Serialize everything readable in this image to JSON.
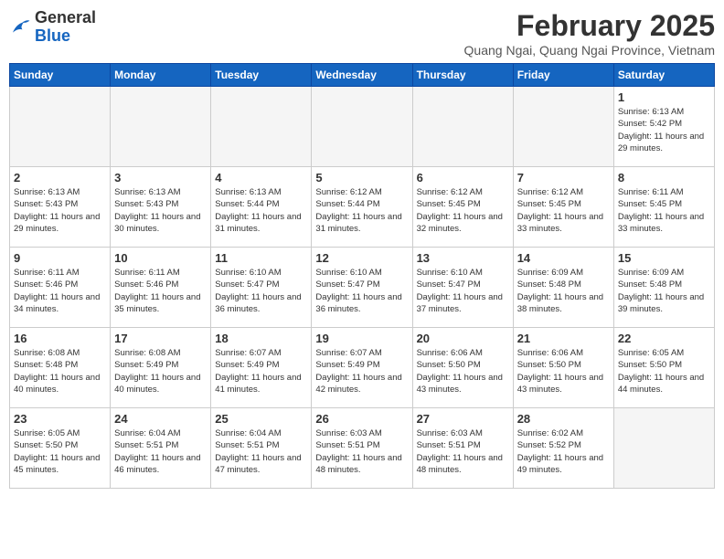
{
  "header": {
    "logo_general": "General",
    "logo_blue": "Blue",
    "title": "February 2025",
    "subtitle": "Quang Ngai, Quang Ngai Province, Vietnam"
  },
  "days_of_week": [
    "Sunday",
    "Monday",
    "Tuesday",
    "Wednesday",
    "Thursday",
    "Friday",
    "Saturday"
  ],
  "weeks": [
    [
      {
        "day": null
      },
      {
        "day": null
      },
      {
        "day": null
      },
      {
        "day": null
      },
      {
        "day": null
      },
      {
        "day": null
      },
      {
        "day": 1,
        "sunrise": "6:13 AM",
        "sunset": "5:42 PM",
        "daylight": "11 hours and 29 minutes."
      }
    ],
    [
      {
        "day": 2,
        "sunrise": "6:13 AM",
        "sunset": "5:43 PM",
        "daylight": "11 hours and 29 minutes."
      },
      {
        "day": 3,
        "sunrise": "6:13 AM",
        "sunset": "5:43 PM",
        "daylight": "11 hours and 30 minutes."
      },
      {
        "day": 4,
        "sunrise": "6:13 AM",
        "sunset": "5:44 PM",
        "daylight": "11 hours and 31 minutes."
      },
      {
        "day": 5,
        "sunrise": "6:12 AM",
        "sunset": "5:44 PM",
        "daylight": "11 hours and 31 minutes."
      },
      {
        "day": 6,
        "sunrise": "6:12 AM",
        "sunset": "5:45 PM",
        "daylight": "11 hours and 32 minutes."
      },
      {
        "day": 7,
        "sunrise": "6:12 AM",
        "sunset": "5:45 PM",
        "daylight": "11 hours and 33 minutes."
      },
      {
        "day": 8,
        "sunrise": "6:11 AM",
        "sunset": "5:45 PM",
        "daylight": "11 hours and 33 minutes."
      }
    ],
    [
      {
        "day": 9,
        "sunrise": "6:11 AM",
        "sunset": "5:46 PM",
        "daylight": "11 hours and 34 minutes."
      },
      {
        "day": 10,
        "sunrise": "6:11 AM",
        "sunset": "5:46 PM",
        "daylight": "11 hours and 35 minutes."
      },
      {
        "day": 11,
        "sunrise": "6:10 AM",
        "sunset": "5:47 PM",
        "daylight": "11 hours and 36 minutes."
      },
      {
        "day": 12,
        "sunrise": "6:10 AM",
        "sunset": "5:47 PM",
        "daylight": "11 hours and 36 minutes."
      },
      {
        "day": 13,
        "sunrise": "6:10 AM",
        "sunset": "5:47 PM",
        "daylight": "11 hours and 37 minutes."
      },
      {
        "day": 14,
        "sunrise": "6:09 AM",
        "sunset": "5:48 PM",
        "daylight": "11 hours and 38 minutes."
      },
      {
        "day": 15,
        "sunrise": "6:09 AM",
        "sunset": "5:48 PM",
        "daylight": "11 hours and 39 minutes."
      }
    ],
    [
      {
        "day": 16,
        "sunrise": "6:08 AM",
        "sunset": "5:48 PM",
        "daylight": "11 hours and 40 minutes."
      },
      {
        "day": 17,
        "sunrise": "6:08 AM",
        "sunset": "5:49 PM",
        "daylight": "11 hours and 40 minutes."
      },
      {
        "day": 18,
        "sunrise": "6:07 AM",
        "sunset": "5:49 PM",
        "daylight": "11 hours and 41 minutes."
      },
      {
        "day": 19,
        "sunrise": "6:07 AM",
        "sunset": "5:49 PM",
        "daylight": "11 hours and 42 minutes."
      },
      {
        "day": 20,
        "sunrise": "6:06 AM",
        "sunset": "5:50 PM",
        "daylight": "11 hours and 43 minutes."
      },
      {
        "day": 21,
        "sunrise": "6:06 AM",
        "sunset": "5:50 PM",
        "daylight": "11 hours and 43 minutes."
      },
      {
        "day": 22,
        "sunrise": "6:05 AM",
        "sunset": "5:50 PM",
        "daylight": "11 hours and 44 minutes."
      }
    ],
    [
      {
        "day": 23,
        "sunrise": "6:05 AM",
        "sunset": "5:50 PM",
        "daylight": "11 hours and 45 minutes."
      },
      {
        "day": 24,
        "sunrise": "6:04 AM",
        "sunset": "5:51 PM",
        "daylight": "11 hours and 46 minutes."
      },
      {
        "day": 25,
        "sunrise": "6:04 AM",
        "sunset": "5:51 PM",
        "daylight": "11 hours and 47 minutes."
      },
      {
        "day": 26,
        "sunrise": "6:03 AM",
        "sunset": "5:51 PM",
        "daylight": "11 hours and 48 minutes."
      },
      {
        "day": 27,
        "sunrise": "6:03 AM",
        "sunset": "5:51 PM",
        "daylight": "11 hours and 48 minutes."
      },
      {
        "day": 28,
        "sunrise": "6:02 AM",
        "sunset": "5:52 PM",
        "daylight": "11 hours and 49 minutes."
      },
      {
        "day": null
      }
    ]
  ]
}
